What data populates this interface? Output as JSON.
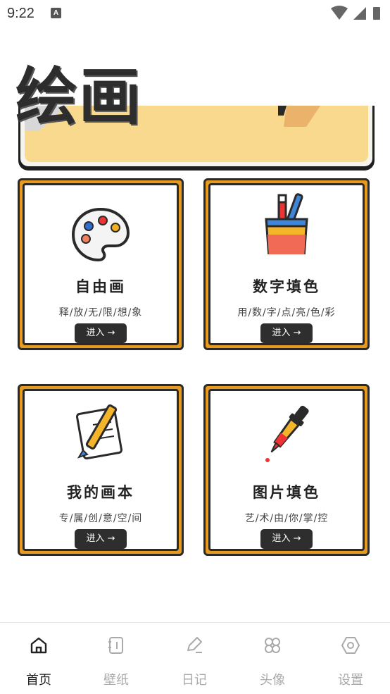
{
  "status_bar": {
    "time": "9:22",
    "notification_letter": "A"
  },
  "banner": {
    "title": "绘画"
  },
  "cards": [
    {
      "title": "自由画",
      "subtitle": "释/放/无/限/想/象",
      "button": "进入 →",
      "icon": "palette-icon"
    },
    {
      "title": "数字填色",
      "subtitle": "用/数/字/点/亮/色/彩",
      "button": "进入 →",
      "icon": "paint-bucket-icon"
    },
    {
      "title": "我的画本",
      "subtitle": "专/属/创/意/空/间",
      "button": "进入 →",
      "icon": "notebook-pencil-icon"
    },
    {
      "title": "图片填色",
      "subtitle": "艺/术/由/你/掌/控",
      "button": "进入 →",
      "icon": "dropper-icon"
    }
  ],
  "tabbar": {
    "items": [
      {
        "label": "首页",
        "icon": "home-icon",
        "active": true
      },
      {
        "label": "壁纸",
        "icon": "wallpaper-icon",
        "active": false
      },
      {
        "label": "日记",
        "icon": "edit-icon",
        "active": false
      },
      {
        "label": "头像",
        "icon": "grid-icon",
        "active": false
      },
      {
        "label": "设置",
        "icon": "settings-icon",
        "active": false
      }
    ]
  },
  "colors": {
    "card_border": "#e89a1e",
    "banner_fill": "#f8d98d",
    "button_bg": "#2e2e2e"
  }
}
